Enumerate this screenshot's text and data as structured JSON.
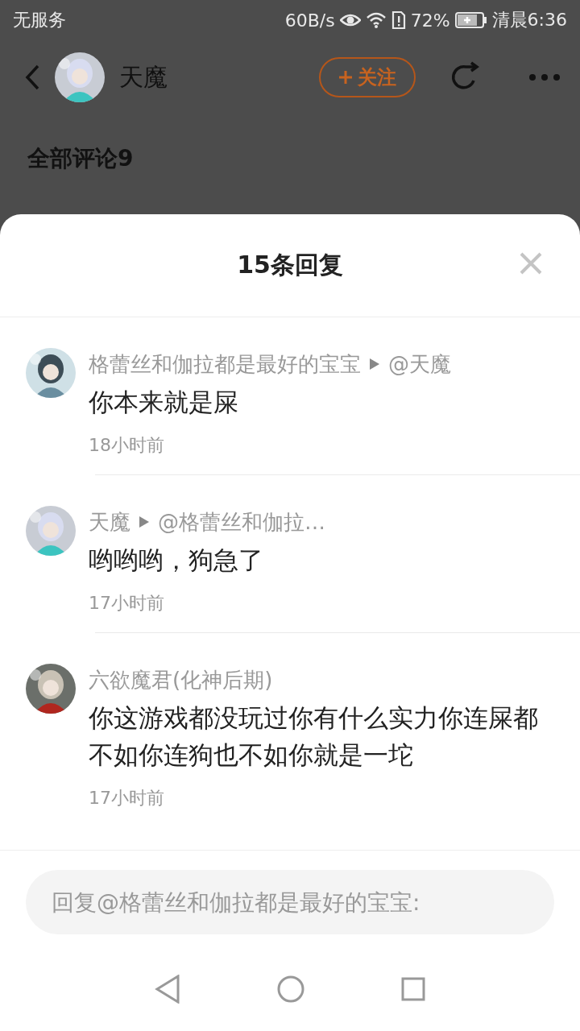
{
  "status_bar": {
    "carrier": "无服务",
    "speed": "60B/s",
    "battery": "72%",
    "time": "清晨6:36"
  },
  "header": {
    "user_name": "天魔",
    "follow_button": "关注"
  },
  "section_title": "全部评论9",
  "sheet": {
    "title": "15条回复",
    "replies": [
      {
        "name": "格蕾丝和伽拉都是最好的宝宝",
        "reply_to": "@天魔",
        "text": "你本来就是屎",
        "time": "18小时前"
      },
      {
        "name": "天魔",
        "reply_to": "@格蕾丝和伽拉…",
        "text": "哟哟哟，狗急了",
        "time": "17小时前"
      },
      {
        "name": "六欲魔君(化神后期)",
        "text": "你这游戏都没玩过你有什么实力你连屎都不如你连狗也不如你就是一坨",
        "time": "17小时前"
      }
    ],
    "reply_input": {
      "placeholder": "回复@格蕾丝和伽拉都是最好的宝宝:"
    }
  }
}
